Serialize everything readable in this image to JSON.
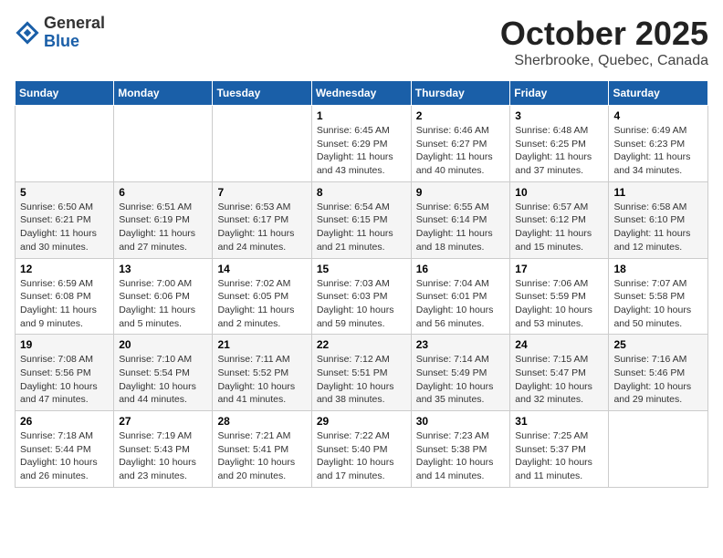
{
  "logo": {
    "general": "General",
    "blue": "Blue"
  },
  "title": "October 2025",
  "subtitle": "Sherbrooke, Quebec, Canada",
  "days_of_week": [
    "Sunday",
    "Monday",
    "Tuesday",
    "Wednesday",
    "Thursday",
    "Friday",
    "Saturday"
  ],
  "weeks": [
    [
      {
        "day": "",
        "info": ""
      },
      {
        "day": "",
        "info": ""
      },
      {
        "day": "",
        "info": ""
      },
      {
        "day": "1",
        "info": "Sunrise: 6:45 AM\nSunset: 6:29 PM\nDaylight: 11 hours and 43 minutes."
      },
      {
        "day": "2",
        "info": "Sunrise: 6:46 AM\nSunset: 6:27 PM\nDaylight: 11 hours and 40 minutes."
      },
      {
        "day": "3",
        "info": "Sunrise: 6:48 AM\nSunset: 6:25 PM\nDaylight: 11 hours and 37 minutes."
      },
      {
        "day": "4",
        "info": "Sunrise: 6:49 AM\nSunset: 6:23 PM\nDaylight: 11 hours and 34 minutes."
      }
    ],
    [
      {
        "day": "5",
        "info": "Sunrise: 6:50 AM\nSunset: 6:21 PM\nDaylight: 11 hours and 30 minutes."
      },
      {
        "day": "6",
        "info": "Sunrise: 6:51 AM\nSunset: 6:19 PM\nDaylight: 11 hours and 27 minutes."
      },
      {
        "day": "7",
        "info": "Sunrise: 6:53 AM\nSunset: 6:17 PM\nDaylight: 11 hours and 24 minutes."
      },
      {
        "day": "8",
        "info": "Sunrise: 6:54 AM\nSunset: 6:15 PM\nDaylight: 11 hours and 21 minutes."
      },
      {
        "day": "9",
        "info": "Sunrise: 6:55 AM\nSunset: 6:14 PM\nDaylight: 11 hours and 18 minutes."
      },
      {
        "day": "10",
        "info": "Sunrise: 6:57 AM\nSunset: 6:12 PM\nDaylight: 11 hours and 15 minutes."
      },
      {
        "day": "11",
        "info": "Sunrise: 6:58 AM\nSunset: 6:10 PM\nDaylight: 11 hours and 12 minutes."
      }
    ],
    [
      {
        "day": "12",
        "info": "Sunrise: 6:59 AM\nSunset: 6:08 PM\nDaylight: 11 hours and 9 minutes."
      },
      {
        "day": "13",
        "info": "Sunrise: 7:00 AM\nSunset: 6:06 PM\nDaylight: 11 hours and 5 minutes."
      },
      {
        "day": "14",
        "info": "Sunrise: 7:02 AM\nSunset: 6:05 PM\nDaylight: 11 hours and 2 minutes."
      },
      {
        "day": "15",
        "info": "Sunrise: 7:03 AM\nSunset: 6:03 PM\nDaylight: 10 hours and 59 minutes."
      },
      {
        "day": "16",
        "info": "Sunrise: 7:04 AM\nSunset: 6:01 PM\nDaylight: 10 hours and 56 minutes."
      },
      {
        "day": "17",
        "info": "Sunrise: 7:06 AM\nSunset: 5:59 PM\nDaylight: 10 hours and 53 minutes."
      },
      {
        "day": "18",
        "info": "Sunrise: 7:07 AM\nSunset: 5:58 PM\nDaylight: 10 hours and 50 minutes."
      }
    ],
    [
      {
        "day": "19",
        "info": "Sunrise: 7:08 AM\nSunset: 5:56 PM\nDaylight: 10 hours and 47 minutes."
      },
      {
        "day": "20",
        "info": "Sunrise: 7:10 AM\nSunset: 5:54 PM\nDaylight: 10 hours and 44 minutes."
      },
      {
        "day": "21",
        "info": "Sunrise: 7:11 AM\nSunset: 5:52 PM\nDaylight: 10 hours and 41 minutes."
      },
      {
        "day": "22",
        "info": "Sunrise: 7:12 AM\nSunset: 5:51 PM\nDaylight: 10 hours and 38 minutes."
      },
      {
        "day": "23",
        "info": "Sunrise: 7:14 AM\nSunset: 5:49 PM\nDaylight: 10 hours and 35 minutes."
      },
      {
        "day": "24",
        "info": "Sunrise: 7:15 AM\nSunset: 5:47 PM\nDaylight: 10 hours and 32 minutes."
      },
      {
        "day": "25",
        "info": "Sunrise: 7:16 AM\nSunset: 5:46 PM\nDaylight: 10 hours and 29 minutes."
      }
    ],
    [
      {
        "day": "26",
        "info": "Sunrise: 7:18 AM\nSunset: 5:44 PM\nDaylight: 10 hours and 26 minutes."
      },
      {
        "day": "27",
        "info": "Sunrise: 7:19 AM\nSunset: 5:43 PM\nDaylight: 10 hours and 23 minutes."
      },
      {
        "day": "28",
        "info": "Sunrise: 7:21 AM\nSunset: 5:41 PM\nDaylight: 10 hours and 20 minutes."
      },
      {
        "day": "29",
        "info": "Sunrise: 7:22 AM\nSunset: 5:40 PM\nDaylight: 10 hours and 17 minutes."
      },
      {
        "day": "30",
        "info": "Sunrise: 7:23 AM\nSunset: 5:38 PM\nDaylight: 10 hours and 14 minutes."
      },
      {
        "day": "31",
        "info": "Sunrise: 7:25 AM\nSunset: 5:37 PM\nDaylight: 10 hours and 11 minutes."
      },
      {
        "day": "",
        "info": ""
      }
    ]
  ]
}
